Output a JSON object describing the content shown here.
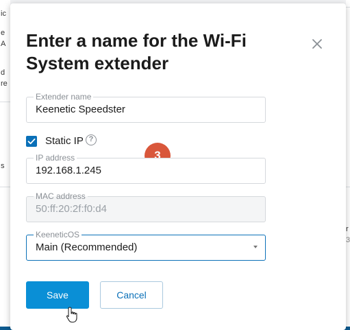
{
  "dialog": {
    "title": "Enter a name for the Wi-Fi System extender",
    "fields": {
      "extender_name": {
        "label": "Extender name",
        "value": "Keenetic Speedster"
      },
      "ip_address": {
        "label": "IP address",
        "value": "192.168.1.245"
      },
      "mac_address": {
        "label": "MAC address",
        "value": "50:ff:20:2f:f0:d4"
      },
      "os": {
        "label": "KeeneticOS",
        "value": "Main (Recommended)"
      }
    },
    "static_ip": {
      "label": "Static IP",
      "checked": true,
      "help_glyph": "?"
    },
    "step_badge": "3",
    "buttons": {
      "save": "Save",
      "cancel": "Cancel"
    }
  },
  "background_fragments": [
    "ic",
    "e",
    "A",
    "d",
    "re",
    "s",
    "r",
    "3"
  ],
  "colors": {
    "accent": "#0a8fd6",
    "badge": "#d9573b",
    "bottom_bar": "#0d5a8f"
  },
  "icons": [
    "close-icon",
    "check-icon",
    "help-icon",
    "chevron-down-icon",
    "hand-cursor-icon"
  ]
}
